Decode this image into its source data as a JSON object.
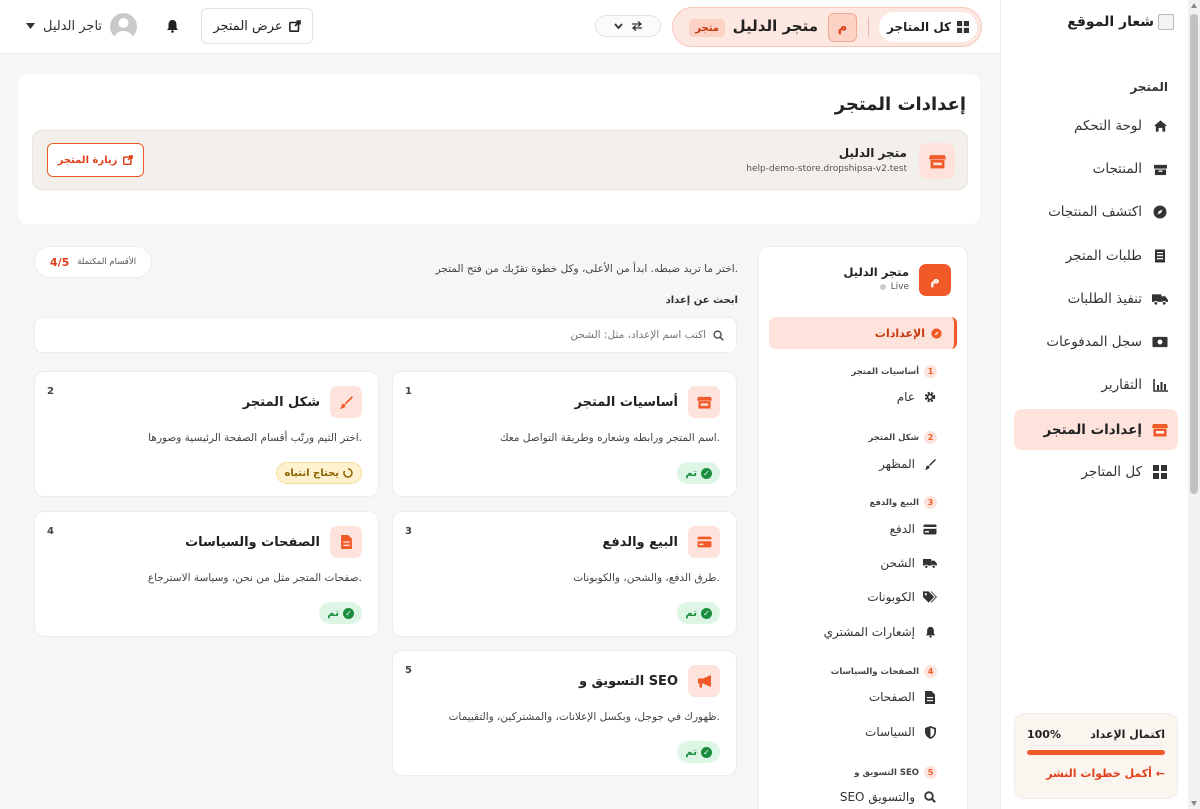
{
  "sidebar": {
    "logo_alt": "شعار الموقع",
    "section": "المتجر",
    "items": [
      {
        "label": "لوحة التحكم",
        "icon": "home-icon"
      },
      {
        "label": "المنتجات",
        "icon": "boxes-icon"
      },
      {
        "label": "اكتشف المنتجات",
        "icon": "compass-icon"
      },
      {
        "label": "طلبات المتجر",
        "icon": "receipt-icon"
      },
      {
        "label": "تنفيذ الطلبات",
        "icon": "truck-icon"
      },
      {
        "label": "سجل المدفوعات",
        "icon": "money-icon"
      },
      {
        "label": "التقارير",
        "icon": "chart-icon"
      },
      {
        "label": "إعدادات المتجر",
        "icon": "store-icon",
        "active": true
      },
      {
        "label": "كل المتاجر",
        "icon": "grid-icon"
      }
    ],
    "progress": {
      "title": "اكتمال الإعداد",
      "percent_text": "100%",
      "percent": 100,
      "link": "أكمل خطوات النشر ←"
    }
  },
  "topbar": {
    "all_stores": "كل المتاجر",
    "store_initial": "م",
    "store_name": "متجر الدليل",
    "store_tag": "متجر",
    "view_store": "عرض المتجر",
    "user_name": "تاجر الدليل"
  },
  "header": {
    "page_title": "إعدادات المتجر",
    "store_name": "متجر الدليل",
    "store_url": "help-demo-store.dropshipsa-v2.test",
    "visit_button": "زيارة المتجر"
  },
  "settings_nav": {
    "store_initial": "م",
    "store_name": "متجر الدليل",
    "status": "Live",
    "active_item": "الإعدادات",
    "groups": [
      {
        "num": "1",
        "label": "أساسيات المتجر",
        "items": [
          {
            "label": "عام",
            "icon": "gear-icon"
          }
        ]
      },
      {
        "num": "2",
        "label": "شكل المتجر",
        "items": [
          {
            "label": "المظهر",
            "icon": "brush-icon"
          }
        ]
      },
      {
        "num": "3",
        "label": "البيع والدفع",
        "items": [
          {
            "label": "الدفع",
            "icon": "card-icon"
          },
          {
            "label": "الشحن",
            "icon": "truck-icon"
          },
          {
            "label": "الكوبونات",
            "icon": "tags-icon"
          },
          {
            "label": "إشعارات المشتري",
            "icon": "bell-icon"
          }
        ]
      },
      {
        "num": "4",
        "label": "الصفحات والسياسات",
        "items": [
          {
            "label": "الصفحات",
            "icon": "file-icon"
          },
          {
            "label": "السياسات",
            "icon": "shield-icon"
          }
        ]
      },
      {
        "num": "5",
        "label": "التسويق و SEO",
        "items": [
          {
            "label": "SEO والتسويق",
            "icon": "search-icon"
          }
        ]
      }
    ]
  },
  "main": {
    "completed_label": "الأقسام المكتملة",
    "completed_value": "4/5",
    "intro": "اختر ما تريد ضبطه. ابدأ من الأعلى، وكل خطوة تقرّبك من فتح المتجر.",
    "search_label": "ابحث عن إعداد",
    "search_placeholder": "اكتب اسم الإعداد، مثل: الشحن",
    "cards": [
      {
        "num": "1",
        "title": "أساسيات المتجر",
        "desc": "اسم المتجر ورابطه وشعاره وطريقة التواصل معك.",
        "status": "تم",
        "state": "done",
        "icon": "store-icon"
      },
      {
        "num": "2",
        "title": "شكل المتجر",
        "desc": "اختر الثيم ورتّب أقسام الصفحة الرئيسية وصورها.",
        "status": "يحتاج انتباه",
        "state": "warn",
        "icon": "brush-icon"
      },
      {
        "num": "3",
        "title": "البيع والدفع",
        "desc": "طرق الدفع، والشحن، والكوبونات.",
        "status": "تم",
        "state": "done",
        "icon": "card-icon"
      },
      {
        "num": "4",
        "title": "الصفحات والسياسات",
        "desc": "صفحات المتجر مثل من نحن، وسياسة الاسترجاع.",
        "status": "تم",
        "state": "done",
        "icon": "file-icon"
      },
      {
        "num": "5",
        "title": "التسويق و SEO",
        "desc": "ظهورك في جوجل، وبكسل الإعلانات، والمشتركين، والتقييمات.",
        "status": "تم",
        "state": "done",
        "icon": "megaphone-icon"
      }
    ]
  },
  "colors": {
    "accent": "#f05a28",
    "accent_soft": "#fde3dc",
    "success": "#1a8c3e"
  }
}
